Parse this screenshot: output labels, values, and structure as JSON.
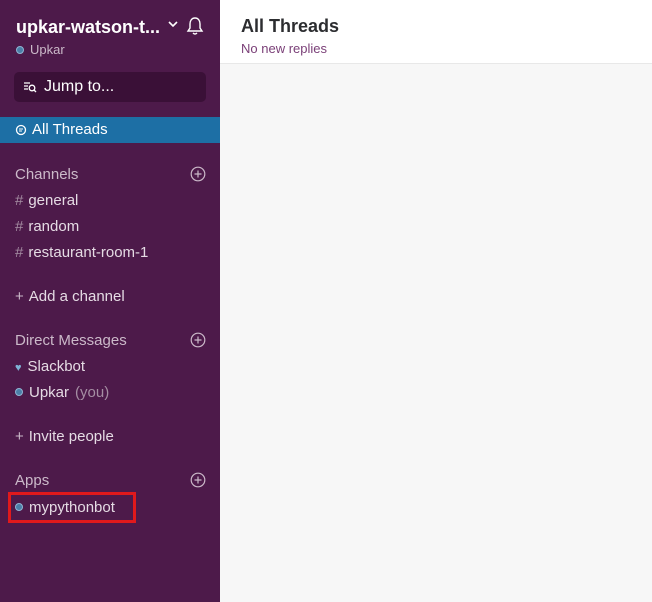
{
  "workspace": {
    "name": "upkar-watson-t...",
    "user": "Upkar"
  },
  "jump_to": {
    "label": "Jump to..."
  },
  "threads": {
    "label": "All Threads"
  },
  "channels": {
    "header": "Channels",
    "items": [
      "general",
      "random",
      "restaurant-room-1"
    ],
    "add_label": "Add a channel"
  },
  "direct_messages": {
    "header": "Direct Messages",
    "items": [
      {
        "name": "Slackbot"
      },
      {
        "name": "Upkar",
        "suffix": "(you)"
      }
    ],
    "invite_label": "Invite people"
  },
  "apps": {
    "header": "Apps",
    "items": [
      "mypythonbot"
    ]
  },
  "main": {
    "title": "All Threads",
    "subtitle": "No new replies"
  },
  "colors": {
    "sidebar_bg": "#4d1a4a",
    "active_item_bg": "#1d6fa5",
    "highlight_box": "#e0191c",
    "subtitle": "#7a3f77"
  },
  "icons": [
    "chevron-down-icon",
    "bell-icon",
    "jump-to-icon",
    "threads-icon",
    "add-circle-icon",
    "heart-icon",
    "presence-dot-icon"
  ]
}
